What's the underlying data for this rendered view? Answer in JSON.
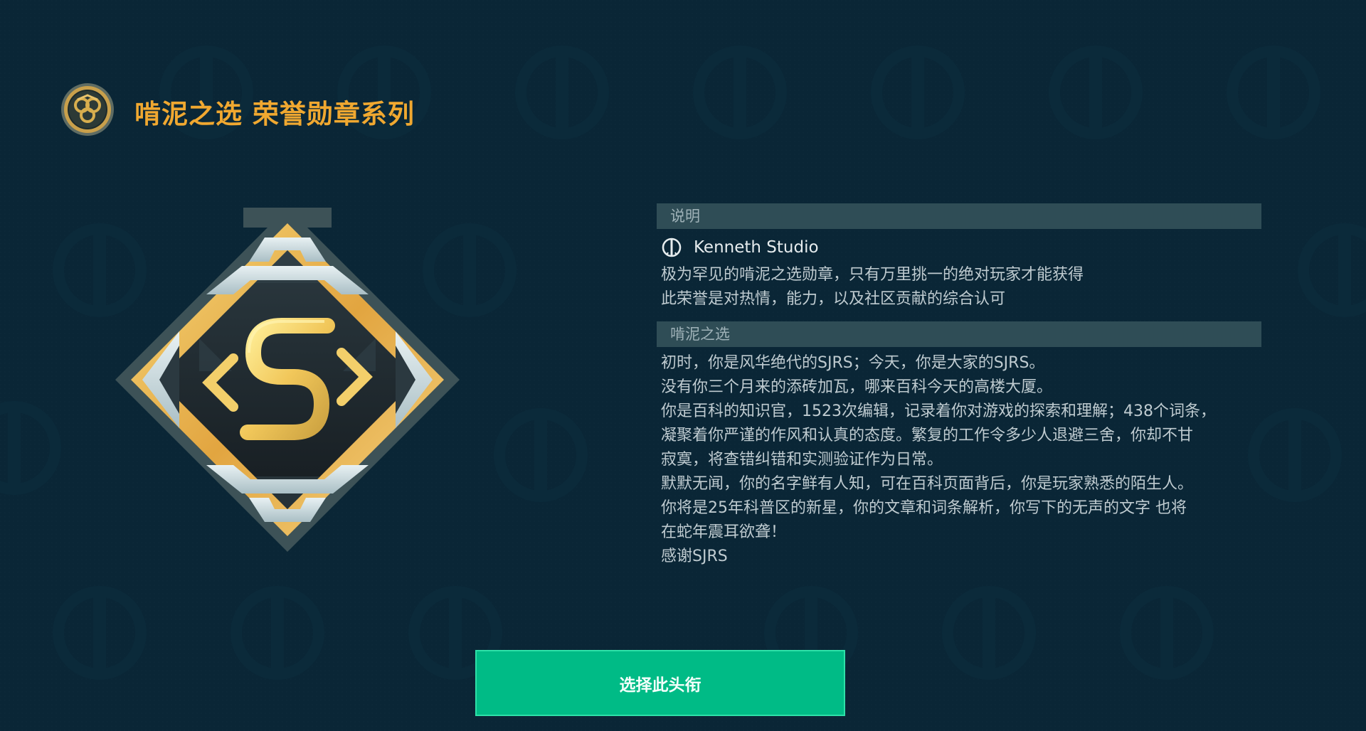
{
  "header": {
    "title": "啃泥之选 荣誉勋章系列",
    "emblem_icon": "medal-emblem-icon"
  },
  "badge": {
    "icon": "sjrs-honor-badge-icon",
    "colors": {
      "gold": "#e8b04a",
      "silver": "#c9d9de",
      "rim": "#3f5459",
      "dark": "#1d2428"
    }
  },
  "info": {
    "section1_title": "说明",
    "studio_icon": "kenneth-studio-logo-icon",
    "studio_name": "Kenneth Studio",
    "desc_lines": [
      "极为罕见的啃泥之选勋章，只有万里挑一的绝对玩家才能获得",
      "此荣誉是对热情，能力，以及社区贡献的综合认可"
    ],
    "section2_title": "啃泥之选",
    "story_lines": [
      "初时，你是风华绝代的SJRS；今天，你是大家的SJRS。",
      "没有你三个月来的添砖加瓦，哪来百科今天的高楼大厦。",
      "你是百科的知识官，1523次编辑，记录着你对游戏的探索和理解；438个词条，",
      "凝聚着你严谨的作风和认真的态度。繁复的工作令多少人退避三舍，你却不甘",
      "寂寞，将查错纠错和实测验证作为日常。",
      "默默无闻，你的名字鲜有人知，可在百科页面背后，你是玩家熟悉的陌生人。",
      "你将是25年科普区的新星，你的文章和词条解析，你写下的无声的文字  也将",
      "在蛇年震耳欲聋！",
      "感谢SJRS"
    ]
  },
  "button": {
    "label": "选择此头衔",
    "color": "#00bb86"
  }
}
